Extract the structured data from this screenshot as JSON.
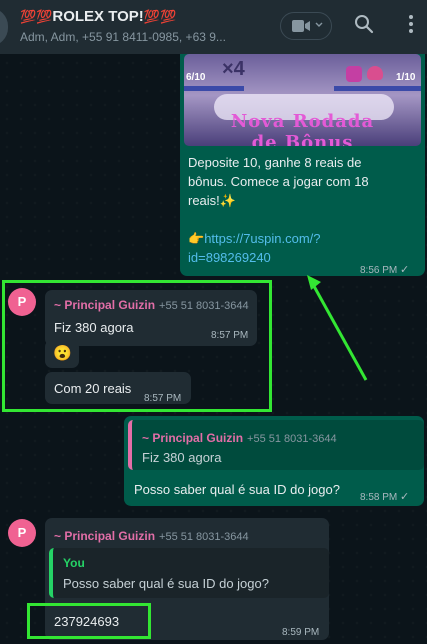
{
  "header": {
    "title": "ROLEX TOP!",
    "title_emoji": "💯💯",
    "subtitle": "Adm, Adm, +55 91 8411-0985, +63 9...",
    "icons": [
      "video-icon",
      "chevron-down-icon",
      "search-icon",
      "menu-icon"
    ]
  },
  "bonus": {
    "banner_left": "6/10",
    "banner_mult": "×4",
    "banner_right": "1/10",
    "banner_title_1": "Nova Rodada",
    "banner_title_2": "de Bônus",
    "text_1": "Deposite 10, ganhe 8 reais de",
    "text_2": "bônus. Comece a jogar com 18",
    "text_3": "reais!✨",
    "pointer": "👉",
    "link_1": "https://7uspin.com/?",
    "link_2": "id=898269240",
    "time": "8:56 PM"
  },
  "msg_guizin_1": {
    "avatar": "P",
    "sender": "~ Principal Guizin",
    "phone": "+55 51 8031-3644",
    "text": "Fiz 380 agora",
    "time": "8:57 PM",
    "emoji": "😮",
    "text2": "Com 20 reais",
    "time2": "8:57 PM"
  },
  "reply_out": {
    "quote_sender": "~ Principal Guizin",
    "quote_phone": "+55 51 8031-3644",
    "quote_text": "Fiz 380 agora",
    "text": "Posso saber qual é sua ID do jogo?",
    "time": "8:58 PM"
  },
  "msg_guizin_2": {
    "avatar": "P",
    "sender": "~ Principal Guizin",
    "phone": "+55 51 8031-3644",
    "quote_sender": "You",
    "quote_text": "Posso saber qual é sua ID do jogo?",
    "text": "237924693",
    "time": "8:59 PM"
  },
  "colors": {
    "highlight": "#33e633",
    "outgoing": "#005c4b",
    "incoming": "#202c33",
    "sender": "#e26ea7",
    "you": "#25d366"
  }
}
